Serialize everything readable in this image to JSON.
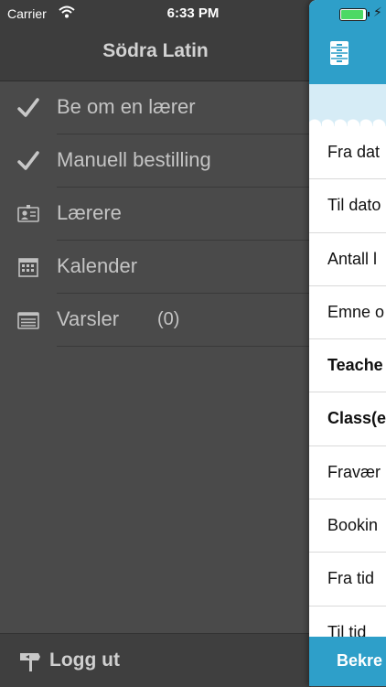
{
  "status_bar": {
    "carrier": "Carrier",
    "time": "6:33 PM"
  },
  "menu": {
    "title": "Södra Latin",
    "items": [
      {
        "label": "Be om en lærer",
        "icon": "checkmark-icon"
      },
      {
        "label": "Manuell bestilling",
        "icon": "checkmark-icon"
      },
      {
        "label": "Lærere",
        "icon": "contact-card-icon"
      },
      {
        "label": "Kalender",
        "icon": "calendar-icon"
      },
      {
        "label": "Varsler",
        "icon": "list-icon",
        "count": "(0)"
      }
    ],
    "footer": {
      "label": "Logg ut",
      "icon": "signpost-icon"
    }
  },
  "panel": {
    "rows": [
      {
        "label": "Fra dat"
      },
      {
        "label": "Til dato"
      },
      {
        "label": "Antall l"
      },
      {
        "label": "Emne o"
      },
      {
        "label": "Teache"
      },
      {
        "label": "Class(e"
      },
      {
        "label": "Fravær"
      },
      {
        "label": "Bookin"
      },
      {
        "label": "Fra tid"
      },
      {
        "label": "Til tid"
      }
    ],
    "confirm_label": "Bekre"
  },
  "colors": {
    "menu_background": "#4a4a4a",
    "accent": "#2e9fc9"
  }
}
